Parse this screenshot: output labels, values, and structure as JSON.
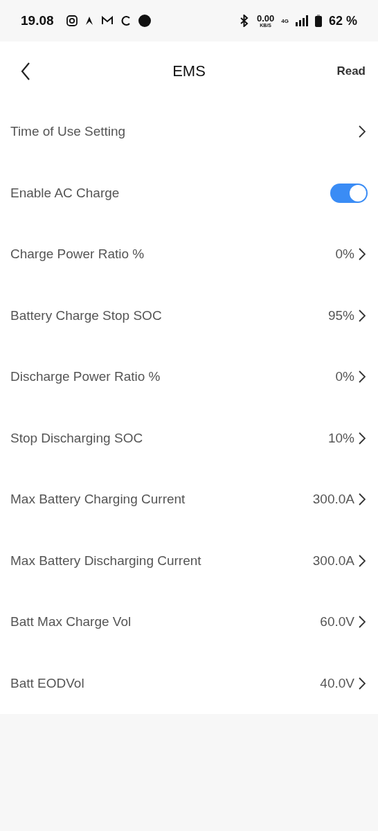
{
  "status_bar": {
    "time": "19.08",
    "speed": "0.00",
    "speed_unit": "KB/S",
    "network": "4G",
    "battery": "62 %"
  },
  "header": {
    "title": "EMS",
    "action": "Read"
  },
  "rows": [
    {
      "kind": "link",
      "label": "Time of Use Setting"
    },
    {
      "kind": "toggle",
      "label": "Enable AC Charge",
      "on": true
    },
    {
      "kind": "link",
      "label": "Charge Power Ratio %",
      "value": "0%"
    },
    {
      "kind": "link",
      "label": "Battery Charge Stop SOC",
      "value": "95%"
    },
    {
      "kind": "link",
      "label": "Discharge Power Ratio %",
      "value": "0%"
    },
    {
      "kind": "link",
      "label": "Stop Discharging SOC",
      "value": "10%"
    },
    {
      "kind": "link",
      "label": "Max Battery Charging Current",
      "value": "300.0A"
    },
    {
      "kind": "link",
      "label": "Max Battery Discharging Current",
      "value": "300.0A"
    },
    {
      "kind": "link",
      "label": "Batt Max Charge Vol",
      "value": "60.0V"
    },
    {
      "kind": "link",
      "label": "Batt EODVol",
      "value": "40.0V"
    }
  ]
}
